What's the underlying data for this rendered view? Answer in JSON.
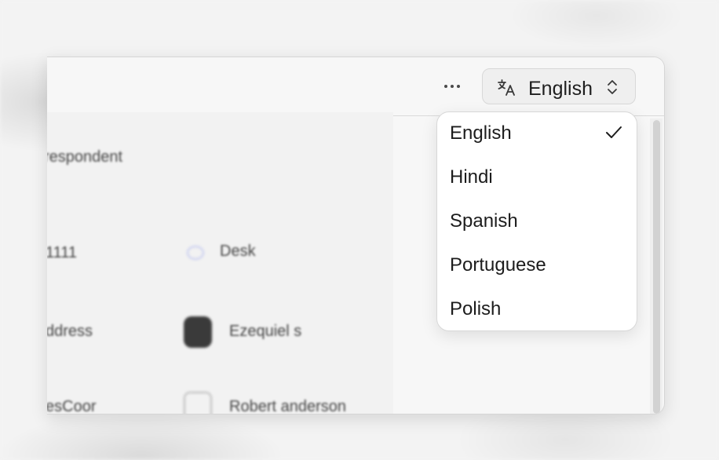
{
  "toolbar": {
    "more_icon": "more-horizontal-icon",
    "language_icon": "translate-icon",
    "selected_language": "English",
    "chevron_icon": "chevron-up-down-icon"
  },
  "dropdown": {
    "options": [
      {
        "label": "English",
        "selected": true
      },
      {
        "label": "Hindi",
        "selected": false
      },
      {
        "label": "Spanish",
        "selected": false
      },
      {
        "label": "Portuguese",
        "selected": false
      },
      {
        "label": "Polish",
        "selected": false
      }
    ],
    "check_icon": "checkmark-icon"
  },
  "colors": {
    "background": "#f3f3f3",
    "window": "#f7f7f7",
    "dropdown": "#ffffff",
    "text": "#1c1c1c"
  }
}
